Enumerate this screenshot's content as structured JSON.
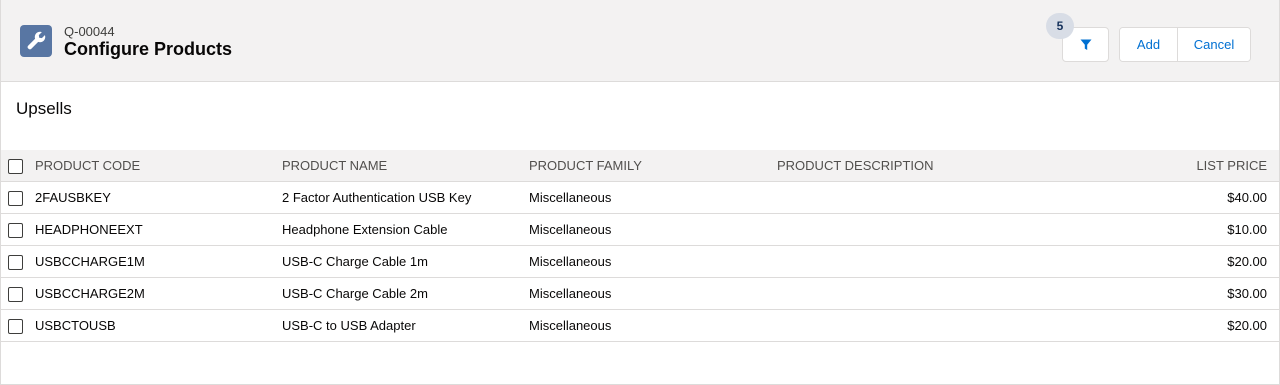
{
  "header": {
    "quote_number": "Q-00044",
    "title": "Configure Products",
    "filter_count": "5",
    "add_label": "Add",
    "cancel_label": "Cancel"
  },
  "section": {
    "title": "Upsells"
  },
  "table": {
    "columns": {
      "code": "PRODUCT CODE",
      "name": "PRODUCT NAME",
      "family": "PRODUCT FAMILY",
      "description": "PRODUCT DESCRIPTION",
      "price": "LIST PRICE"
    },
    "rows": [
      {
        "code": "2FAUSBKEY",
        "name": "2 Factor Authentication USB Key",
        "family": "Miscellaneous",
        "description": "",
        "price": "$40.00"
      },
      {
        "code": "HEADPHONEEXT",
        "name": "Headphone Extension Cable",
        "family": "Miscellaneous",
        "description": "",
        "price": "$10.00"
      },
      {
        "code": "USBCCHARGE1M",
        "name": "USB-C Charge Cable 1m",
        "family": "Miscellaneous",
        "description": "",
        "price": "$20.00"
      },
      {
        "code": "USBCCHARGE2M",
        "name": "USB-C Charge Cable 2m",
        "family": "Miscellaneous",
        "description": "",
        "price": "$30.00"
      },
      {
        "code": "USBCTOUSB",
        "name": "USB-C to USB Adapter",
        "family": "Miscellaneous",
        "description": "",
        "price": "$20.00"
      }
    ]
  },
  "colors": {
    "brand_blue": "#0070d2",
    "icon_bg": "#5876a3",
    "header_bg": "#f3f2f2"
  },
  "icons": {
    "app": "wrench-icon",
    "filter": "filter-icon"
  }
}
